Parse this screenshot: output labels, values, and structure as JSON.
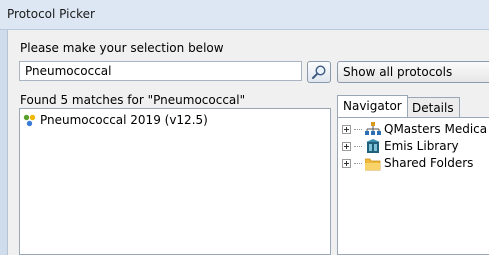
{
  "window": {
    "title": "Protocol Picker"
  },
  "search": {
    "prompt": "Please make your selection below",
    "value": "Pneumococcal"
  },
  "filter": {
    "selected": "Show all protocols"
  },
  "results": {
    "summary": "Found 5 matches for \"Pneumococcal\"",
    "items": [
      {
        "label": "Pneumococcal 2019 (v12.5)",
        "icon": "protocol-icon"
      }
    ]
  },
  "tabs": [
    {
      "label": "Navigator",
      "active": true
    },
    {
      "label": "Details",
      "active": false
    }
  ],
  "tree": [
    {
      "label": "QMasters Medica",
      "icon": "org-chart-icon"
    },
    {
      "label": "Emis Library",
      "icon": "library-icon"
    },
    {
      "label": "Shared Folders",
      "icon": "folder-icon"
    }
  ]
}
